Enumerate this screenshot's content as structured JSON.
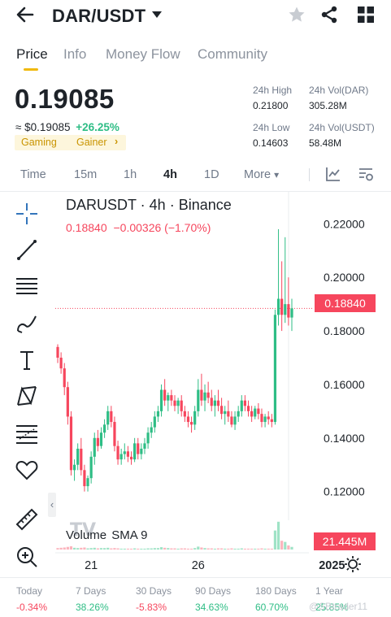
{
  "header": {
    "title": "DAR/USDT",
    "back_icon": "arrow-left-icon",
    "dropdown_icon": "caret-down-icon",
    "star_icon": "star-icon",
    "share_icon": "share-icon",
    "grid_icon": "grid-icon"
  },
  "tabs": [
    {
      "label": "Price",
      "active": true
    },
    {
      "label": "Info"
    },
    {
      "label": "Money Flow"
    },
    {
      "label": "Community"
    }
  ],
  "ticker": {
    "price": "0.19085",
    "usd_price": "≈ $0.19085",
    "change": "+26.25%",
    "tags": [
      "Gaming",
      "Gainer"
    ],
    "tag_arrow": "›",
    "stats": {
      "high_label": "24h High",
      "high_value": "0.21800",
      "vol_base_label": "24h Vol(DAR)",
      "vol_base_value": "305.28M",
      "low_label": "24h Low",
      "low_value": "0.14603",
      "vol_quote_label": "24h Vol(USDT)",
      "vol_quote_value": "58.48M"
    }
  },
  "timeframes": {
    "items": [
      "Time",
      "15m",
      "1h",
      "4h",
      "1D",
      "More"
    ],
    "active": "4h",
    "more_caret": "▾"
  },
  "chart": {
    "title": "DARUSDT · 4h · Binance",
    "last_price": "0.18840",
    "last_change": "−0.00326 (−1.70%)",
    "volume_title": "Volume",
    "volume_indicator": "SMA 9",
    "volume_value": "21.445M",
    "collapse_arrow": "‹"
  },
  "chart_data": {
    "type": "candlestick",
    "title": "DARUSDT · 4h · Binance",
    "ylim": [
      0.112,
      0.228
    ],
    "y_ticks": [
      "0.22000",
      "0.20000",
      "0.18000",
      "0.16000",
      "0.14000",
      "0.12000"
    ],
    "y_tick_values": [
      0.22,
      0.2,
      0.18,
      0.16,
      0.14,
      0.12
    ],
    "x_ticks": [
      "21",
      "26",
      "2025"
    ],
    "x_tick_index": [
      10,
      42,
      82
    ],
    "last_price": 0.1884,
    "last_volume": "21.445M",
    "colors": {
      "up": "#2ebd85",
      "down": "#f6465d"
    },
    "candles": [
      [
        0.174,
        0.175,
        0.168,
        0.17
      ],
      [
        0.17,
        0.172,
        0.164,
        0.166
      ],
      [
        0.166,
        0.168,
        0.156,
        0.159
      ],
      [
        0.159,
        0.161,
        0.145,
        0.148
      ],
      [
        0.148,
        0.15,
        0.126,
        0.128
      ],
      [
        0.128,
        0.132,
        0.124,
        0.13
      ],
      [
        0.13,
        0.138,
        0.128,
        0.136
      ],
      [
        0.136,
        0.14,
        0.126,
        0.128
      ],
      [
        0.128,
        0.13,
        0.12,
        0.122
      ],
      [
        0.122,
        0.126,
        0.12,
        0.125
      ],
      [
        0.125,
        0.135,
        0.123,
        0.133
      ],
      [
        0.133,
        0.142,
        0.13,
        0.14
      ],
      [
        0.14,
        0.143,
        0.135,
        0.137
      ],
      [
        0.137,
        0.144,
        0.136,
        0.142
      ],
      [
        0.142,
        0.147,
        0.14,
        0.145
      ],
      [
        0.145,
        0.152,
        0.143,
        0.15
      ],
      [
        0.15,
        0.152,
        0.144,
        0.146
      ],
      [
        0.146,
        0.148,
        0.135,
        0.137
      ],
      [
        0.137,
        0.139,
        0.13,
        0.132
      ],
      [
        0.132,
        0.136,
        0.13,
        0.134
      ],
      [
        0.134,
        0.138,
        0.132,
        0.135
      ],
      [
        0.135,
        0.137,
        0.131,
        0.133
      ],
      [
        0.133,
        0.135,
        0.13,
        0.132
      ],
      [
        0.132,
        0.14,
        0.131,
        0.138
      ],
      [
        0.138,
        0.14,
        0.132,
        0.134
      ],
      [
        0.134,
        0.138,
        0.132,
        0.136
      ],
      [
        0.136,
        0.14,
        0.134,
        0.138
      ],
      [
        0.138,
        0.144,
        0.136,
        0.142
      ],
      [
        0.142,
        0.146,
        0.14,
        0.144
      ],
      [
        0.144,
        0.15,
        0.142,
        0.148
      ],
      [
        0.148,
        0.152,
        0.146,
        0.15
      ],
      [
        0.15,
        0.16,
        0.148,
        0.158
      ],
      [
        0.158,
        0.162,
        0.152,
        0.154
      ],
      [
        0.154,
        0.157,
        0.15,
        0.156
      ],
      [
        0.156,
        0.158,
        0.152,
        0.154
      ],
      [
        0.154,
        0.156,
        0.15,
        0.152
      ],
      [
        0.152,
        0.155,
        0.149,
        0.154
      ],
      [
        0.154,
        0.156,
        0.148,
        0.15
      ],
      [
        0.15,
        0.152,
        0.146,
        0.148
      ],
      [
        0.148,
        0.15,
        0.144,
        0.146
      ],
      [
        0.146,
        0.148,
        0.142,
        0.145
      ],
      [
        0.145,
        0.152,
        0.143,
        0.15
      ],
      [
        0.15,
        0.162,
        0.148,
        0.158
      ],
      [
        0.158,
        0.164,
        0.152,
        0.154
      ],
      [
        0.154,
        0.16,
        0.15,
        0.157
      ],
      [
        0.157,
        0.161,
        0.153,
        0.155
      ],
      [
        0.155,
        0.158,
        0.15,
        0.152
      ],
      [
        0.152,
        0.156,
        0.148,
        0.154
      ],
      [
        0.154,
        0.158,
        0.15,
        0.152
      ],
      [
        0.152,
        0.155,
        0.147,
        0.149
      ],
      [
        0.149,
        0.152,
        0.145,
        0.15
      ],
      [
        0.15,
        0.154,
        0.146,
        0.148
      ],
      [
        0.148,
        0.15,
        0.144,
        0.145
      ],
      [
        0.145,
        0.15,
        0.143,
        0.148
      ],
      [
        0.148,
        0.152,
        0.146,
        0.15
      ],
      [
        0.15,
        0.156,
        0.148,
        0.154
      ],
      [
        0.154,
        0.156,
        0.15,
        0.152
      ],
      [
        0.152,
        0.154,
        0.148,
        0.15
      ],
      [
        0.15,
        0.152,
        0.146,
        0.148
      ],
      [
        0.148,
        0.152,
        0.147,
        0.151
      ],
      [
        0.151,
        0.153,
        0.147,
        0.149
      ],
      [
        0.149,
        0.151,
        0.144,
        0.146
      ],
      [
        0.146,
        0.149,
        0.144,
        0.148
      ],
      [
        0.148,
        0.15,
        0.145,
        0.147
      ],
      [
        0.147,
        0.149,
        0.144,
        0.146
      ],
      [
        0.146,
        0.188,
        0.145,
        0.186
      ],
      [
        0.186,
        0.218,
        0.182,
        0.192
      ],
      [
        0.192,
        0.206,
        0.18,
        0.186
      ],
      [
        0.186,
        0.215,
        0.183,
        0.19
      ],
      [
        0.19,
        0.2,
        0.182,
        0.185
      ],
      [
        0.185,
        0.192,
        0.18,
        0.1884
      ]
    ],
    "volumes": [
      0.5,
      0.6,
      0.7,
      0.9,
      1.1,
      0.6,
      0.5,
      0.6,
      0.7,
      0.4,
      0.5,
      0.6,
      0.4,
      0.5,
      0.5,
      0.6,
      0.4,
      0.5,
      0.4,
      0.3,
      0.3,
      0.3,
      0.3,
      0.4,
      0.3,
      0.3,
      0.3,
      0.4,
      0.4,
      0.5,
      0.5,
      0.8,
      0.6,
      0.5,
      0.4,
      0.4,
      0.3,
      0.4,
      0.4,
      0.3,
      0.3,
      0.5,
      1.0,
      0.7,
      0.5,
      0.4,
      0.4,
      0.3,
      0.4,
      0.4,
      0.3,
      0.3,
      0.4,
      0.3,
      0.3,
      0.4,
      0.3,
      0.3,
      0.3,
      0.3,
      0.3,
      0.4,
      0.3,
      0.3,
      0.3,
      6.5,
      9.5,
      3.0,
      2.6,
      1.4,
      0.9
    ]
  },
  "tools": [
    "crosshair-icon",
    "trend-line-icon",
    "horizontal-lines-icon",
    "brush-icon",
    "text-icon",
    "pattern-icon",
    "fib-icon",
    "heart-icon",
    "ruler-icon",
    "zoom-icon"
  ],
  "performance": [
    {
      "label": "Today",
      "value": "-0.34%",
      "dir": "down"
    },
    {
      "label": "7 Days",
      "value": "38.26%",
      "dir": "up"
    },
    {
      "label": "30 Days",
      "value": "-5.83%",
      "dir": "down"
    },
    {
      "label": "90 Days",
      "value": "34.63%",
      "dir": "up"
    },
    {
      "label": "180 Days",
      "value": "60.70%",
      "dir": "up"
    },
    {
      "label": "1 Year",
      "value": "25.85%",
      "dir": "up"
    }
  ],
  "watermark": "@SBtrader11"
}
